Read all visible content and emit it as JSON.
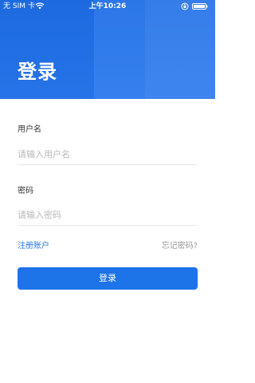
{
  "status_bar": {
    "carrier": "无 SIM 卡",
    "time": "上午10:26"
  },
  "header": {
    "title": "登录"
  },
  "form": {
    "username_label": "用户名",
    "username_placeholder": "请输入用户名",
    "password_label": "密码",
    "password_placeholder": "请输入密码"
  },
  "links": {
    "register": "注册账户",
    "forgot": "忘记密码?"
  },
  "actions": {
    "login": "登录"
  },
  "colors": {
    "primary": "#1d73e8",
    "header_blue": "#2a78ee"
  }
}
